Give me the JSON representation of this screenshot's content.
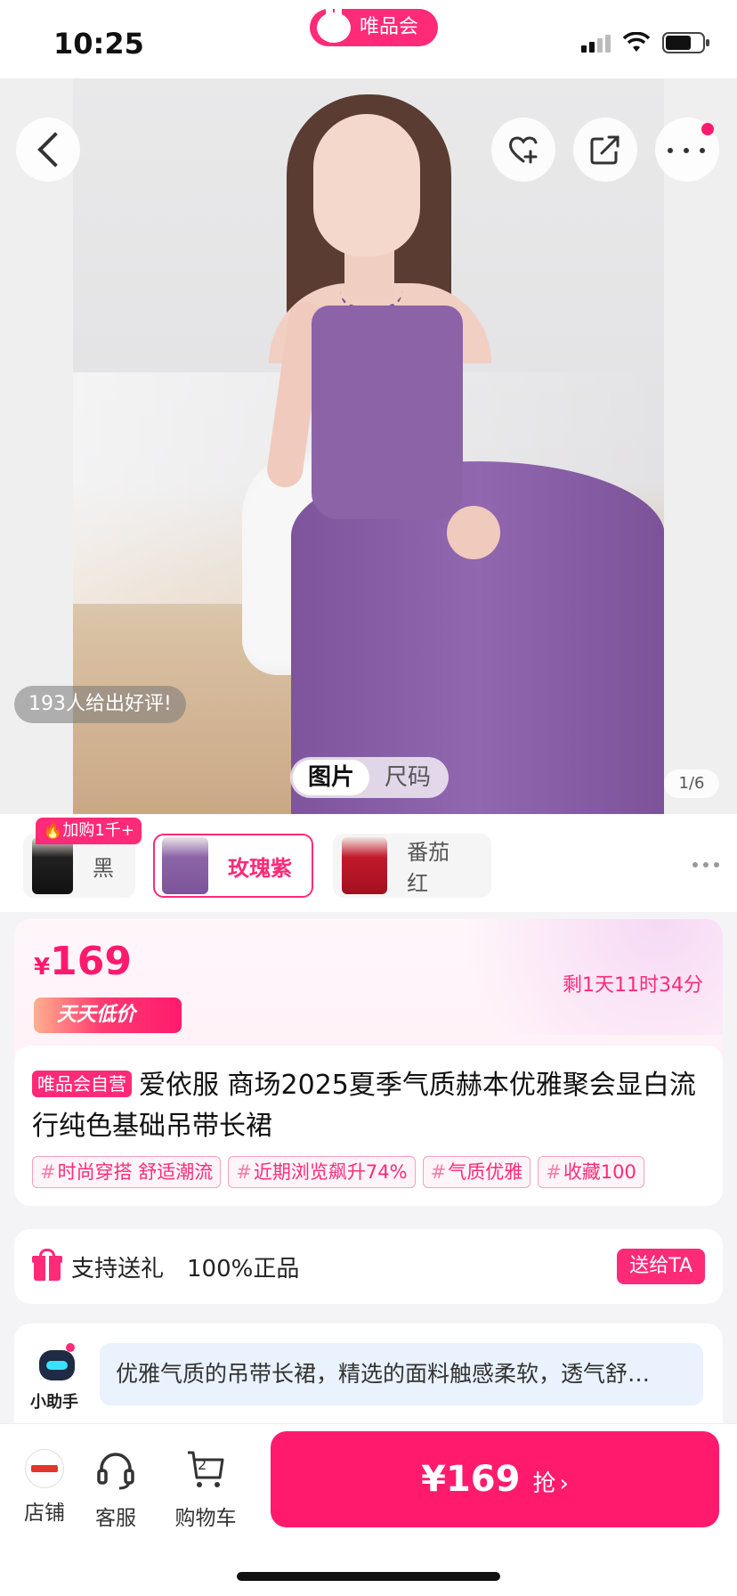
{
  "status_bar": {
    "time": "10:25",
    "app_name": "唯品会",
    "battery_level": 0.7
  },
  "hero": {
    "review_summary": "193人给出好评!",
    "tabs": [
      {
        "label": "图片",
        "active": true
      },
      {
        "label": "尺码",
        "active": false
      }
    ],
    "page_indicator": "1/6"
  },
  "colors": {
    "badge": "加购1千+",
    "options": [
      {
        "label": "黑",
        "selected": false
      },
      {
        "label": "玫瑰紫",
        "selected": true
      },
      {
        "label": "番茄红",
        "selected": false
      }
    ]
  },
  "price": {
    "currency": "¥",
    "amount": "169",
    "countdown": "剩1天11时34分",
    "promo_label": "天天低价"
  },
  "product": {
    "self_operated_badge": "唯品会自营",
    "title": "爱依服 商场2025夏季气质赫本优雅聚会显白流行纯色基础吊带长裙",
    "tags": [
      "时尚穿搭 舒适潮流",
      "近期浏览飙升74%",
      "气质优雅",
      "收藏100"
    ]
  },
  "gift": {
    "support_gift": "支持送礼",
    "authentic": "100%正品",
    "button": "送给TA"
  },
  "assistant": {
    "label": "小助手",
    "message": "优雅气质的吊带长裙，精选的面料触感柔软，透气舒…"
  },
  "bottom_bar": {
    "store_label": "店铺",
    "service_label": "客服",
    "cart_label": "购物车",
    "cart_count": "2",
    "buy_price": "¥169",
    "buy_label": "抢"
  },
  "theme": {
    "accent": "#ff1a6e",
    "dress_color": "#8d63a8",
    "assistant_bubble": "#e9f2fd"
  }
}
